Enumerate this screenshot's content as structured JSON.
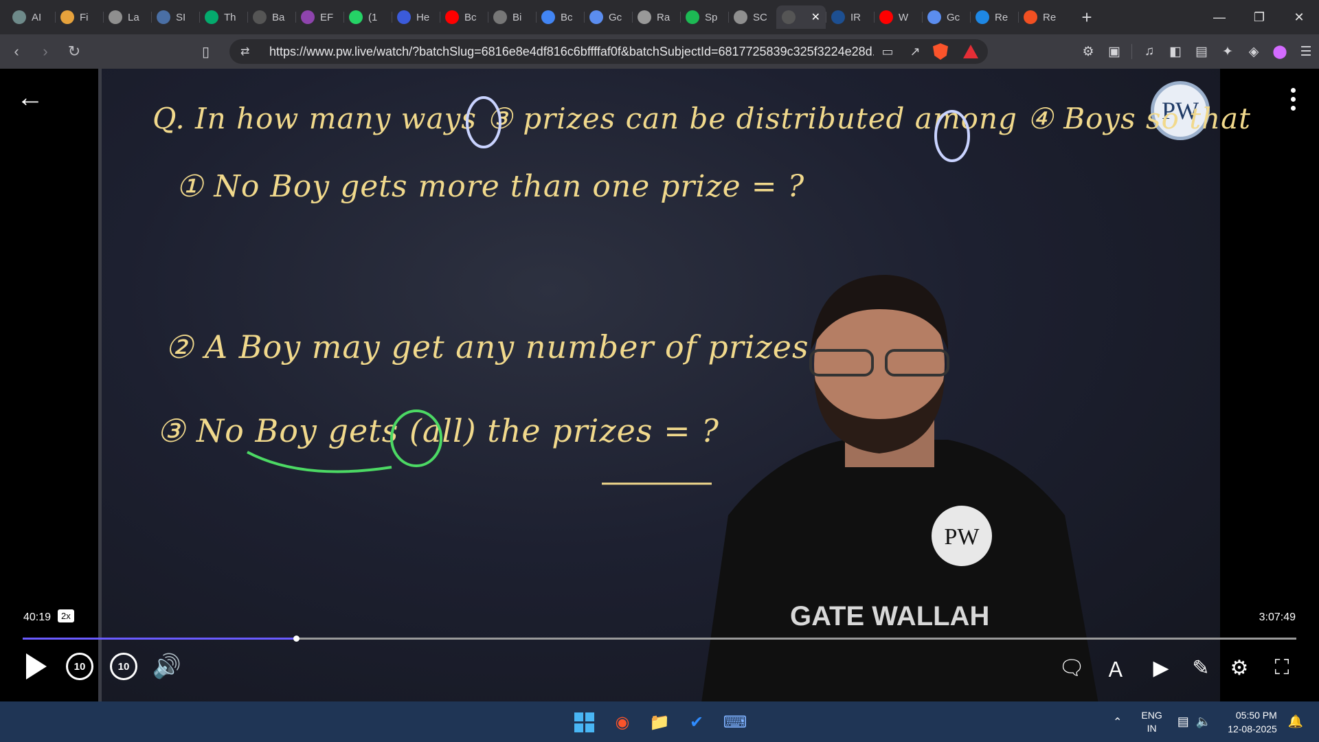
{
  "browser": {
    "tabs": [
      {
        "title": "AI",
        "icon": "chatgpt-icon",
        "color": "#6e8a8a"
      },
      {
        "title": "Fi",
        "icon": "finance-icon",
        "color": "#e6a23c"
      },
      {
        "title": "La",
        "icon": "globe-icon",
        "color": "#8f8f8f"
      },
      {
        "title": "SI",
        "icon": "site-icon",
        "color": "#4a6fa5"
      },
      {
        "title": "Th",
        "icon": "w3schools-icon",
        "color": "#04aa6d"
      },
      {
        "title": "Ba",
        "icon": "page-icon",
        "color": "#555"
      },
      {
        "title": "EF",
        "icon": "ef-icon",
        "color": "#8e44ad"
      },
      {
        "title": "(1",
        "icon": "whatsapp-icon",
        "color": "#25d366"
      },
      {
        "title": "He",
        "icon": "bookmark-tab-icon",
        "color": "#3b5bdb"
      },
      {
        "title": "Bc",
        "icon": "youtube-icon",
        "color": "#ff0000"
      },
      {
        "title": "Bi",
        "icon": "oracle-icon",
        "color": "#777"
      },
      {
        "title": "Bc",
        "icon": "google-icon",
        "color": "#4285f4"
      },
      {
        "title": "Gc",
        "icon": "gemini-icon",
        "color": "#5b8def"
      },
      {
        "title": "Ra",
        "icon": "openai-icon",
        "color": "#999"
      },
      {
        "title": "Sp",
        "icon": "spotify-icon",
        "color": "#1db954"
      },
      {
        "title": "SC",
        "icon": "globe-icon",
        "color": "#8f8f8f"
      },
      {
        "title": "",
        "icon": "pw-tab-icon",
        "color": "#555",
        "active": true
      },
      {
        "title": "IR",
        "icon": "irctc-icon",
        "color": "#1d4f91"
      },
      {
        "title": "W",
        "icon": "youtube-icon",
        "color": "#ff0000"
      },
      {
        "title": "Gc",
        "icon": "gemini-icon",
        "color": "#5b8def"
      },
      {
        "title": "Re",
        "icon": "remote-icon",
        "color": "#1e88e5"
      },
      {
        "title": "Re",
        "icon": "microsoft-icon",
        "color": "#f25022"
      }
    ],
    "new_tab_label": "+",
    "url": "https://www.pw.live/watch/?batchSlug=6816e8e4df816c6bffffaf0f&batchSubjectId=6817725839c325f3224e28d...",
    "shield_count": "1"
  },
  "board": {
    "question": "Q. In how many ways ③ prizes can be distributed among ④ Boys so that",
    "part1": "① No Boy gets more than one prize = ?",
    "part2": "② A Boy may get any number of prizes = ?",
    "part3": "③ No Boy gets (all) the prizes = ?",
    "logo_text": "PW",
    "shirt_text": "GATE WALLAH"
  },
  "player": {
    "current_time": "40:19",
    "speed": "2x",
    "total_time": "3:07:49",
    "progress_fraction": 0.2147,
    "rewind_label": "10",
    "forward_label": "10"
  },
  "taskbar": {
    "lang_line1": "ENG",
    "lang_line2": "IN",
    "time": "05:50 PM",
    "date": "12-08-2025"
  }
}
